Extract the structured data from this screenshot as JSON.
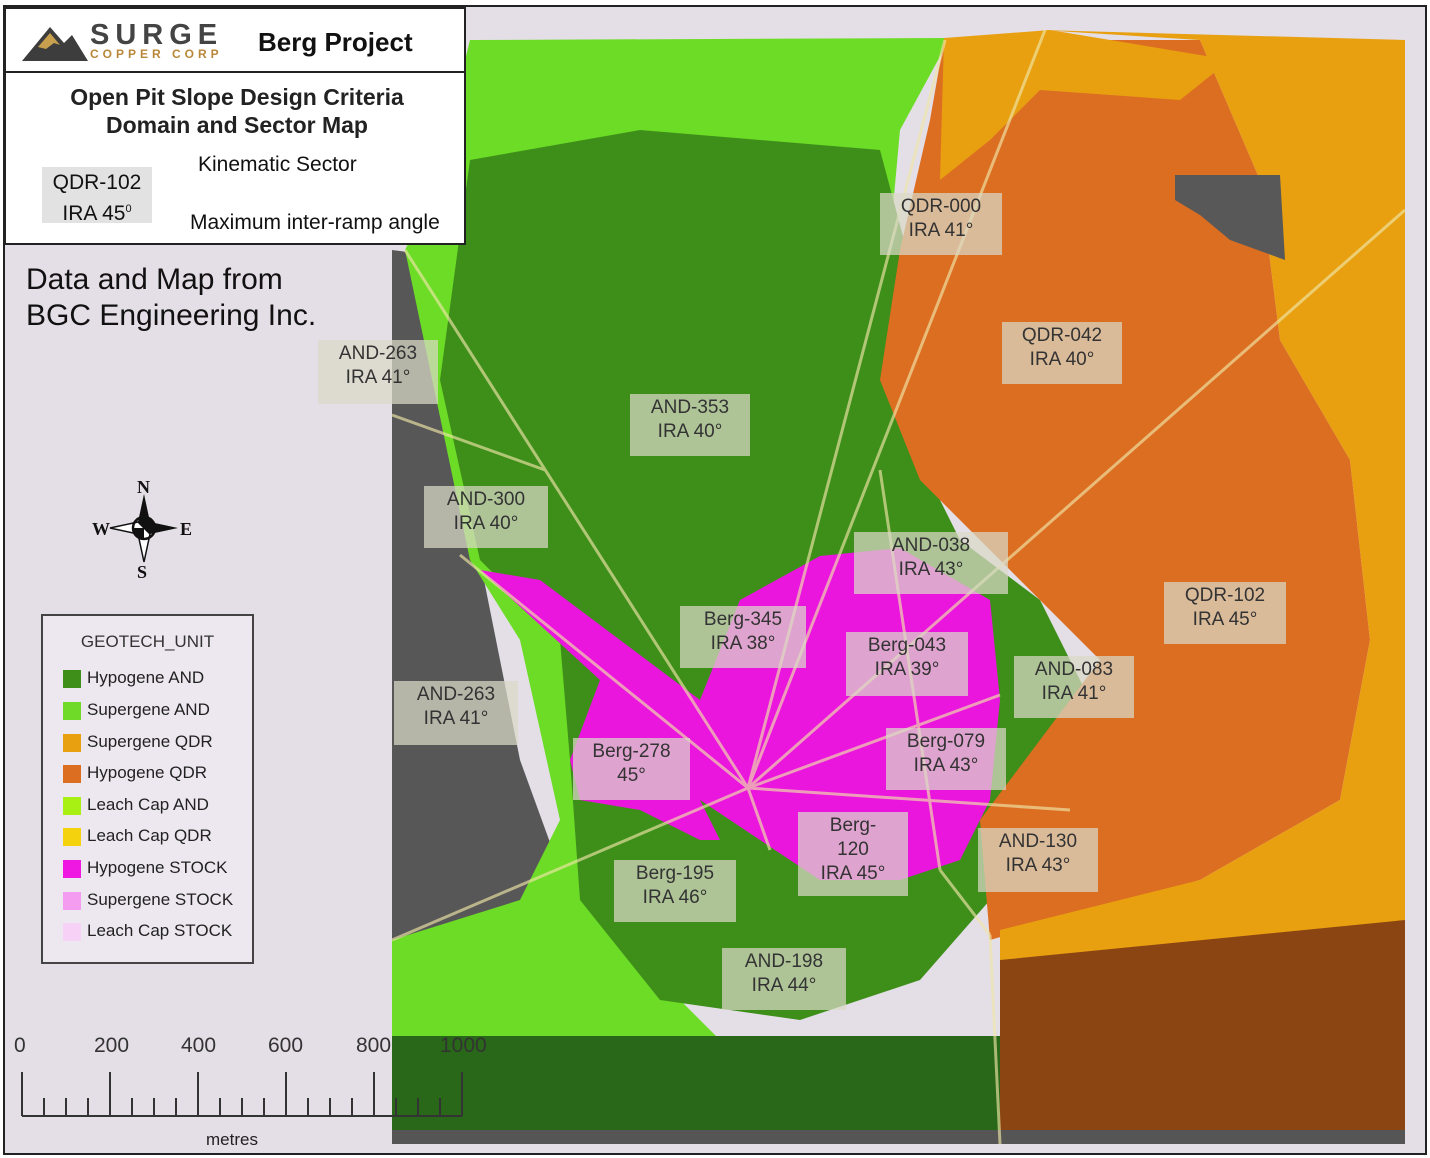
{
  "header": {
    "logo_word": "SURGE",
    "logo_sub": "COPPER CORP",
    "project": "Berg Project",
    "subtitle_line1": "Open Pit Slope Design Criteria",
    "subtitle_line2": "Domain and Sector Map"
  },
  "key": {
    "sector_example": "QDR-102",
    "angle_example": "IRA 45",
    "degree_mark": "0",
    "sector_label": "Kinematic Sector",
    "angle_label": "Maximum inter-ramp angle"
  },
  "credit": {
    "line1": "Data and Map from",
    "line2": "BGC Engineering Inc."
  },
  "compass": {
    "n": "N",
    "s": "S",
    "e": "E",
    "w": "W"
  },
  "legend": {
    "title": "GEOTECH_UNIT",
    "items": [
      {
        "label": "Hypogene AND",
        "color": "#3e8e1a"
      },
      {
        "label": "Supergene AND",
        "color": "#6fdb28"
      },
      {
        "label": "Supergene QDR",
        "color": "#e8a010"
      },
      {
        "label": "Hypogene QDR",
        "color": "#dc6e22"
      },
      {
        "label": "Leach Cap AND",
        "color": "#a8f014"
      },
      {
        "label": "Leach Cap QDR",
        "color": "#f4d20e"
      },
      {
        "label": "Hypogene STOCK",
        "color": "#ee18e2"
      },
      {
        "label": "Supergene STOCK",
        "color": "#f39cf0"
      },
      {
        "label": "Leach Cap STOCK",
        "color": "#f7d2f6"
      }
    ]
  },
  "scale": {
    "ticks": [
      "0",
      "200",
      "400",
      "600",
      "800",
      "1000"
    ],
    "unit": "metres"
  },
  "sectors": {
    "qdr000": [
      "QDR-000",
      "IRA 41°"
    ],
    "qdr042": [
      "QDR-042",
      "IRA 40°"
    ],
    "and263a": [
      "AND-263",
      "IRA 41°"
    ],
    "and353": [
      "AND-353",
      "IRA 40°"
    ],
    "and300": [
      "AND-300",
      "IRA 40°"
    ],
    "and038": [
      "AND-038",
      "IRA 43°"
    ],
    "qdr102": [
      "QDR-102",
      "IRA 45°"
    ],
    "berg345": [
      "Berg-345",
      "IRA 38°"
    ],
    "berg043": [
      "Berg-043",
      "IRA 39°"
    ],
    "and083": [
      "AND-083",
      "IRA 41°"
    ],
    "and263b": [
      "AND-263",
      "IRA 41°"
    ],
    "berg278": [
      "Berg-278",
      "45°"
    ],
    "berg079": [
      "Berg-079",
      "IRA 43°"
    ],
    "berg120": [
      "Berg-",
      "120",
      "IRA 45°"
    ],
    "and130": [
      "AND-130",
      "IRA 43°"
    ],
    "berg195": [
      "Berg-195",
      "IRA 46°"
    ],
    "and198": [
      "AND-198",
      "IRA 44°"
    ]
  },
  "colors": {
    "background": "#e4dee7",
    "dark_rock": "#555555",
    "deep_green": "#286818",
    "brown": "#8b4513"
  }
}
